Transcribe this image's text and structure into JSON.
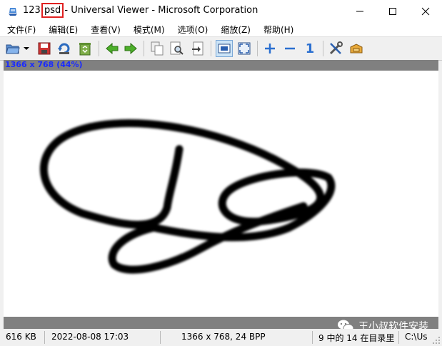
{
  "window": {
    "title_prefix": "123.",
    "title_highlight": "psd",
    "title_suffix": " - Universal Viewer - Microsoft Corporation"
  },
  "menu": [
    {
      "label": "文件(F)"
    },
    {
      "label": "编辑(E)"
    },
    {
      "label": "查看(V)"
    },
    {
      "label": "模式(M)"
    },
    {
      "label": "选项(O)"
    },
    {
      "label": "缩放(Z)"
    },
    {
      "label": "帮助(H)"
    }
  ],
  "toolbar": {
    "zoom_one_label": "1",
    "icons": [
      "open-folder-icon",
      "dropdown-arrow-icon",
      "save-icon",
      "reload-icon",
      "recycle-icon",
      "back-arrow-icon",
      "forward-arrow-icon",
      "copy-icon",
      "find-icon",
      "goto-icon",
      "fit-window-icon",
      "fullscreen-icon",
      "zoom-in-icon",
      "zoom-out-icon",
      "zoom-original-icon",
      "tools-icon",
      "plugins-icon"
    ]
  },
  "image_info": "1366 x 768 (44%)",
  "status": {
    "size": "616 KB",
    "date": "2022-08-08 17:03",
    "dimensions": "1366 x 768, 24 BPP",
    "position": "9 中的 14 在目录里",
    "path": "C:\\Us"
  },
  "watermark": "王小叔软件安装",
  "colors": {
    "info_text": "#1a2bff",
    "highlight_box": "#e02020"
  }
}
